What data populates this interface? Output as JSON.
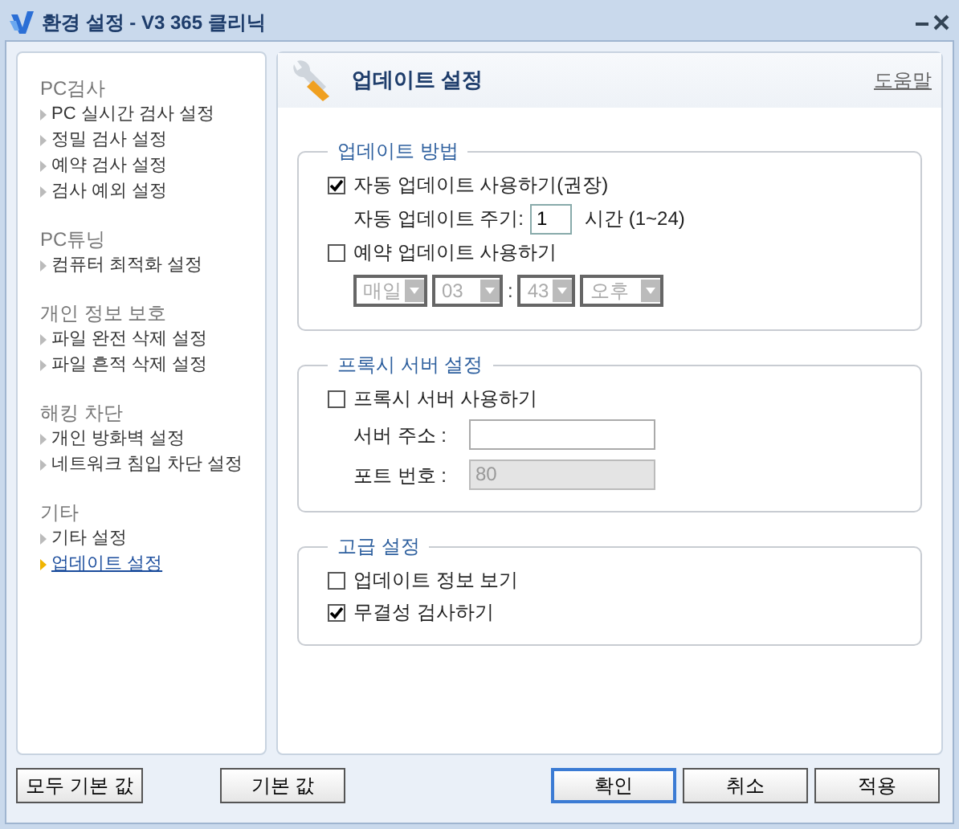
{
  "window": {
    "title": "환경 설정 - V3 365 클리닉"
  },
  "sidebar": {
    "groups": [
      {
        "title": "PC검사",
        "items": [
          {
            "label": "PC 실시간 검사 설정",
            "selected": false
          },
          {
            "label": "정밀 검사 설정",
            "selected": false
          },
          {
            "label": "예약 검사 설정",
            "selected": false
          },
          {
            "label": "검사 예외 설정",
            "selected": false
          }
        ]
      },
      {
        "title": "PC튜닝",
        "items": [
          {
            "label": "컴퓨터 최적화 설정",
            "selected": false
          }
        ]
      },
      {
        "title": "개인 정보 보호",
        "items": [
          {
            "label": "파일 완전 삭제 설정",
            "selected": false
          },
          {
            "label": "파일 흔적 삭제 설정",
            "selected": false
          }
        ]
      },
      {
        "title": "해킹 차단",
        "items": [
          {
            "label": "개인 방화벽 설정",
            "selected": false
          },
          {
            "label": "네트워크 침입 차단 설정",
            "selected": false
          }
        ]
      },
      {
        "title": "기타",
        "items": [
          {
            "label": "기타 설정",
            "selected": false
          },
          {
            "label": "업데이트 설정",
            "selected": true
          }
        ]
      }
    ]
  },
  "panel": {
    "title": "업데이트 설정",
    "help_link": "도움말",
    "sections": [
      {
        "title": "업데이트 방법",
        "rows": [
          {
            "kind": "checkbox",
            "label": "자동 업데이트 사용하기(권장)",
            "checked": true
          },
          {
            "kind": "interval",
            "label": "자동 업데이트 주기:",
            "value": "1",
            "unit": "시간 (1~24)"
          },
          {
            "kind": "checkbox",
            "label": "예약 업데이트 사용하기",
            "checked": false
          },
          {
            "kind": "schedule",
            "disabled": true,
            "day": "매일",
            "hour": "03",
            "separator": ":",
            "minute": "43",
            "ampm": "오후"
          }
        ]
      },
      {
        "title": "프록시 서버 설정",
        "rows": [
          {
            "kind": "checkbox",
            "label": "프록시 서버 사용하기",
            "checked": false
          },
          {
            "kind": "field",
            "label": "서버 주소 :",
            "disabled": false
          },
          {
            "kind": "field",
            "label": "포트 번호 :",
            "value": "80",
            "disabled": true
          }
        ]
      },
      {
        "title": "고급 설정",
        "rows": [
          {
            "kind": "checkbox",
            "label": "업데이트 정보 보기",
            "checked": false
          },
          {
            "kind": "checkbox",
            "label": "무결성 검사하기",
            "checked": true
          }
        ]
      }
    ]
  },
  "buttons": {
    "left": [
      {
        "label": "모두 기본 값",
        "default": false
      },
      {
        "label": "기본 값",
        "default": false
      }
    ],
    "right": [
      {
        "label": "확인",
        "default": true
      },
      {
        "label": "취소",
        "default": false
      },
      {
        "label": "적용",
        "default": false
      }
    ]
  }
}
